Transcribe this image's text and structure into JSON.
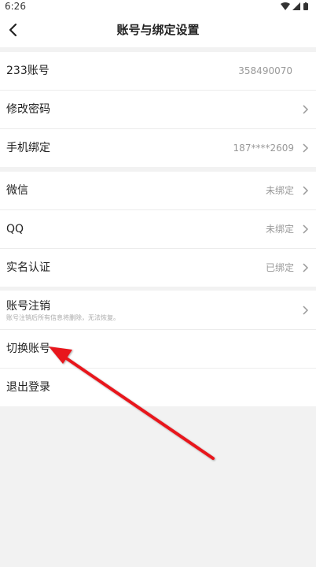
{
  "status_bar": {
    "time": "6:26",
    "icons": [
      "wifi-icon",
      "signal-icon",
      "battery-icon"
    ]
  },
  "header": {
    "title": "账号与绑定设置",
    "back_icon": "chevron-left-icon"
  },
  "account_group": {
    "items": [
      {
        "label": "233账号",
        "value": "358490070",
        "has_arrow": false
      },
      {
        "label": "修改密码",
        "value": "",
        "has_arrow": true
      },
      {
        "label": "手机绑定",
        "value": "187****2609",
        "has_arrow": true
      }
    ]
  },
  "social_group": {
    "items": [
      {
        "label": "微信",
        "value": "未绑定",
        "has_arrow": true
      },
      {
        "label": "QQ",
        "value": "未绑定",
        "has_arrow": true
      },
      {
        "label": "实名认证",
        "value": "已绑定",
        "has_arrow": true
      }
    ]
  },
  "other_group": {
    "cancel_account": {
      "label": "账号注销",
      "subtitle": "账号注销后所有信息将删除，无法恢复。"
    },
    "switch_account": {
      "label": "切换账号"
    },
    "logout": {
      "label": "退出登录"
    }
  },
  "colors": {
    "annotation_arrow": "#e8151b",
    "background": "#f2f2f2",
    "secondary_text": "#999999"
  }
}
